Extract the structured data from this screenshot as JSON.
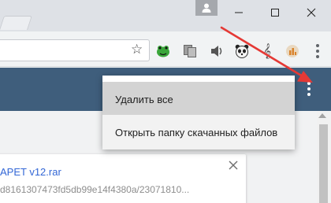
{
  "window": {
    "controls": [
      "minimize",
      "maximize",
      "close"
    ]
  },
  "toolbar": {
    "star_glyph": "☆",
    "extensions": [
      "frog-extension",
      "copy-extension",
      "sound-extension",
      "panda-extension",
      "music-clef-extension",
      "chart-extension"
    ],
    "clef_glyph": "𝄞"
  },
  "downloads": {
    "file_name": "APET v12.rar",
    "file_url": "d8161307473fd5db99e14f4380a/23071810..."
  },
  "menu": {
    "items": [
      {
        "label": "Удалить все"
      },
      {
        "label": "Открыть папку скачанных файлов"
      }
    ]
  },
  "colors": {
    "header": "#3f5e7c",
    "link": "#3367d6",
    "arrow": "#e53935"
  }
}
